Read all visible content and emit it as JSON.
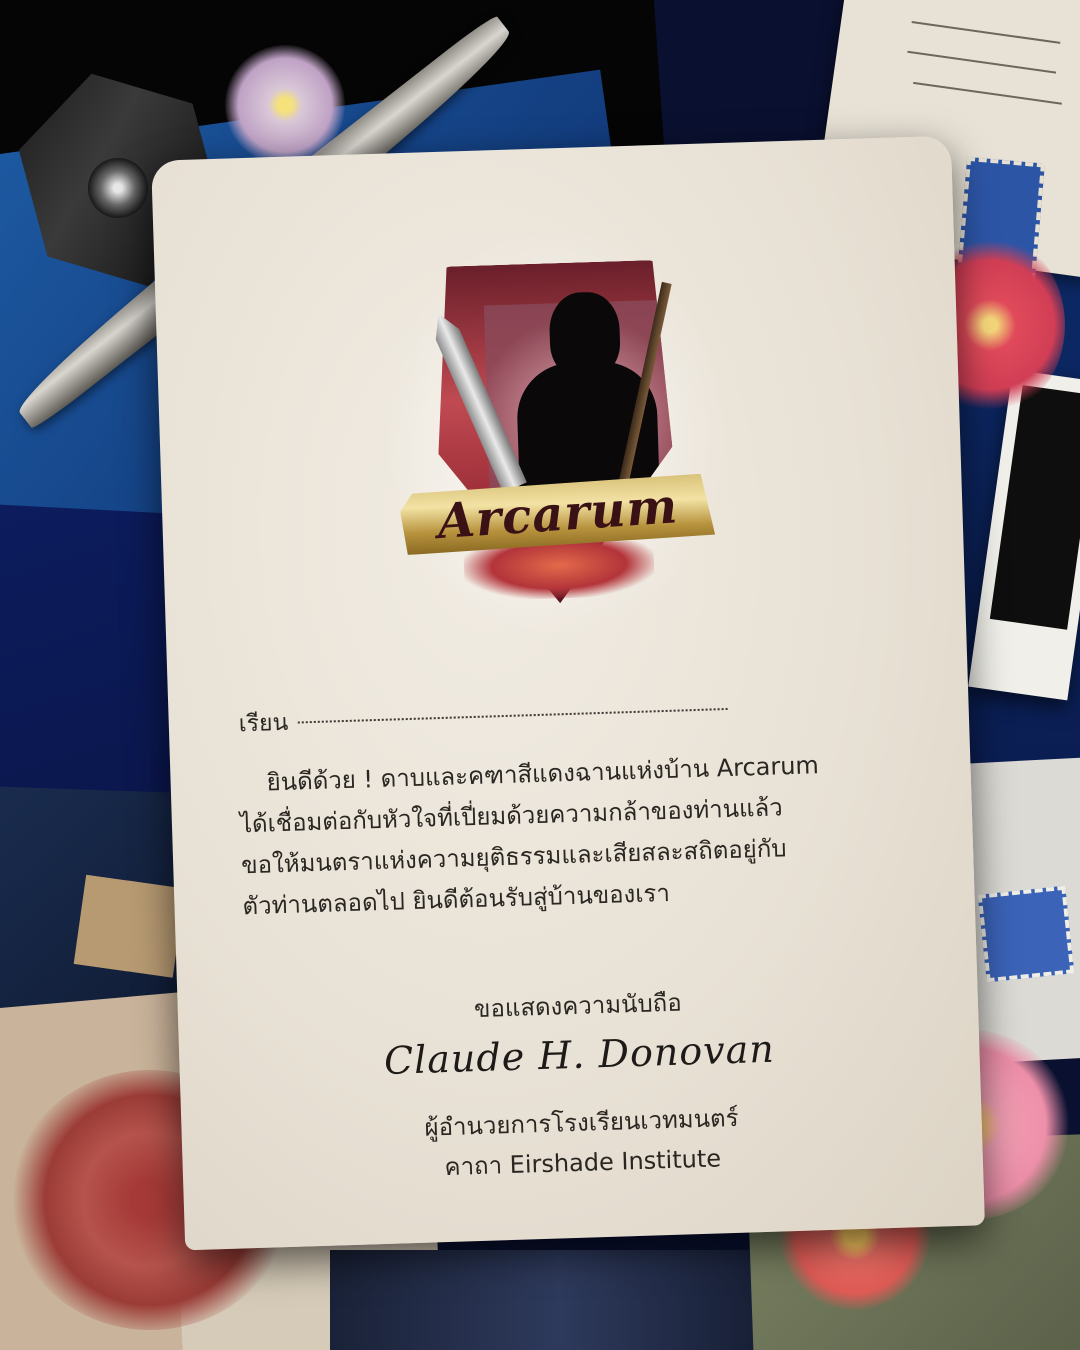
{
  "letter": {
    "crest_banner": "Arcarum",
    "salutation": "เรียน",
    "body_lines": [
      "ยินดีด้วย ! ดาบและคฑาสีแดงฉานแห่งบ้าน Arcarum",
      "ได้เชื่อมต่อกับหัวใจที่เปี่ยมด้วยความกล้าของท่านแล้ว",
      "ขอให้มนตราแห่งความยุติธรรมและเสียสละสถิตอยู่กับ",
      "ตัวท่านตลอดไป ยินดีต้อนรับสู่บ้านของเรา"
    ],
    "closing": "ขอแสดงความนับถือ",
    "signature": "Claude H. Donovan",
    "signer_title_1": "ผู้อำนวยการโรงเรียนเวทมนตร์",
    "signer_title_2": "คาถา Eirshade Institute"
  },
  "colors": {
    "paper": "#e8e1d5",
    "ink": "#2a2622",
    "crest_red": "#9a2c36",
    "banner_gold": "#d9c27a",
    "background_blue": "#16468a"
  }
}
